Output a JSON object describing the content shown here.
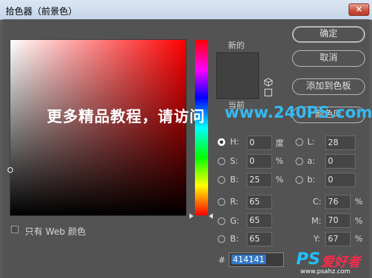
{
  "window": {
    "title": "拾色器（前景色）",
    "close_icon": "×"
  },
  "picker": {
    "web_colors_label": "只有 Web 颜色",
    "new_label": "新的",
    "current_label": "当前",
    "new_color": "#414141",
    "current_color": "#414141"
  },
  "buttons": {
    "ok": "确定",
    "cancel": "取消",
    "add_to_swatches": "添加到色板",
    "color_libraries": "颜色库"
  },
  "watermark": {
    "text_cn": "更多精品教程，请访问",
    "url": "www.240PS.com"
  },
  "hsb": {
    "h": {
      "label": "H:",
      "value": "0",
      "unit": "度"
    },
    "s": {
      "label": "S:",
      "value": "0",
      "unit": "%"
    },
    "b": {
      "label": "B:",
      "value": "25",
      "unit": "%"
    }
  },
  "rgb": {
    "r": {
      "label": "R:",
      "value": "65"
    },
    "g": {
      "label": "G:",
      "value": "65"
    },
    "b": {
      "label": "B:",
      "value": "65"
    }
  },
  "lab": {
    "l": {
      "label": "L:",
      "value": "28"
    },
    "a": {
      "label": "a:",
      "value": "0"
    },
    "b": {
      "label": "b:",
      "value": "0"
    }
  },
  "cmyk": {
    "c": {
      "label": "C:",
      "value": "76",
      "unit": "%"
    },
    "m": {
      "label": "M:",
      "value": "70",
      "unit": "%"
    },
    "y": {
      "label": "Y:",
      "value": "67",
      "unit": "%"
    }
  },
  "hex": {
    "label": "#",
    "value": "414141"
  },
  "logo": {
    "ps": "PS",
    "cn": "爱好者",
    "url": "www.psahz.com"
  }
}
